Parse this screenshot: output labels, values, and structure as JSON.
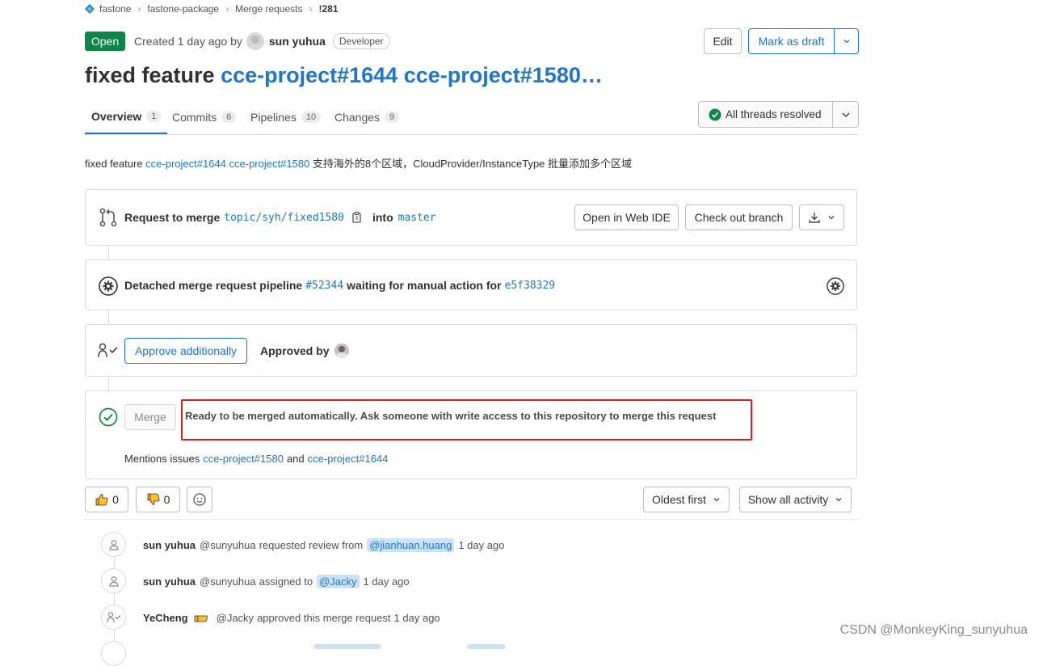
{
  "breadcrumb": {
    "items": [
      "fastone",
      "fastone-package",
      "Merge requests",
      "!281"
    ],
    "separator": "›"
  },
  "header": {
    "status": "Open",
    "created_prefix": "Created 1 day ago by",
    "author": "sun yuhua",
    "role": "Developer",
    "edit_label": "Edit",
    "draft_label": "Mark as draft"
  },
  "title": {
    "plain": "fixed feature ",
    "link1": "cce-project#1644",
    "link2": "cce-project#1580…"
  },
  "tabs": [
    {
      "label": "Overview",
      "count": "1"
    },
    {
      "label": "Commits",
      "count": "6"
    },
    {
      "label": "Pipelines",
      "count": "10"
    },
    {
      "label": "Changes",
      "count": "9"
    }
  ],
  "threads_label": "All threads resolved",
  "description": {
    "prefix": "fixed feature ",
    "link1": "cce-project#1644",
    "link2": "cce-project#1580",
    "suffix": " 支持海外的8个区域，CloudProvider/InstanceType 批量添加多个区域"
  },
  "merge_request": {
    "label": "Request to merge",
    "source_branch": "topic/syh/fixed1580",
    "into_label": "into",
    "target_branch": "master",
    "web_ide_label": "Open in Web IDE",
    "checkout_label": "Check out branch"
  },
  "pipeline": {
    "prefix": "Detached merge request pipeline",
    "id": "#52344",
    "middle": "waiting for manual action for",
    "commit": "e5f38329"
  },
  "approval": {
    "approve_label": "Approve additionally",
    "approved_by_label": "Approved by"
  },
  "merge": {
    "button_label": "Merge",
    "message": "Ready to be merged automatically. Ask someone with write access to this repository to merge this request",
    "mentions_prefix": "Mentions issues",
    "issue1": "cce-project#1580",
    "and": "and",
    "issue2": "cce-project#1644"
  },
  "reactions": {
    "thumbs_up_count": "0",
    "thumbs_down_count": "0"
  },
  "sort_label": "Oldest first",
  "filter_label": "Show all activity",
  "activity": [
    {
      "who": "sun yuhua",
      "handle": "@sunyuhua",
      "action": "requested review from",
      "mention": "@jianhuan.huang",
      "time": "1 day ago"
    },
    {
      "who": "sun yuhua",
      "handle": "@sunyuhua",
      "action": "assigned to",
      "mention": "@Jacky",
      "time": "1 day ago"
    },
    {
      "who": "YeCheng",
      "handle": "@Jacky",
      "action": "approved this merge request",
      "mention": "",
      "time": "1 day ago"
    }
  ],
  "watermark": "CSDN @MonkeyKing_sunyuhua",
  "colors": {
    "brand_blue": "#1f75cb",
    "open_green": "#108548",
    "highlight_red": "#e01b1b",
    "mention_bg": "#cbe2f9"
  }
}
